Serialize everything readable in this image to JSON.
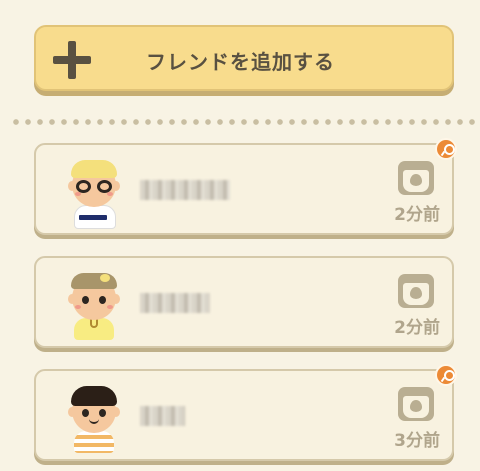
{
  "add_friend": {
    "label": "フレンドを追加する"
  },
  "friends": [
    {
      "time": "2分前",
      "has_badge": true
    },
    {
      "time": "2分前",
      "has_badge": false
    },
    {
      "time": "3分前",
      "has_badge": true
    }
  ],
  "colors": {
    "background": "#f8f3e4",
    "add_button": "#f8dc8d",
    "card": "#f8f2e0",
    "badge": "#ec8a36",
    "muted_text": "#b0a58c"
  }
}
